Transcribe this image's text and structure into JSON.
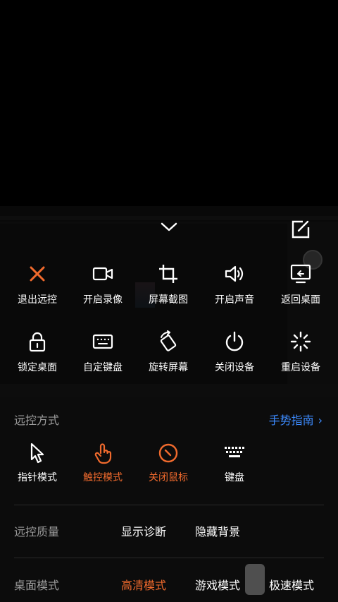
{
  "toolbar": {
    "row1": [
      {
        "label": "退出远控",
        "icon": "close-icon"
      },
      {
        "label": "开启录像",
        "icon": "video-camera-icon"
      },
      {
        "label": "屏幕截图",
        "icon": "crop-icon"
      },
      {
        "label": "开启声音",
        "icon": "speaker-icon"
      },
      {
        "label": "返回桌面",
        "icon": "monitor-return-icon"
      }
    ],
    "row2": [
      {
        "label": "锁定桌面",
        "icon": "lock-icon"
      },
      {
        "label": "自定键盘",
        "icon": "keyboard-icon"
      },
      {
        "label": "旋转屏幕",
        "icon": "rotate-screen-icon"
      },
      {
        "label": "关闭设备",
        "icon": "power-icon"
      },
      {
        "label": "重启设备",
        "icon": "loading-spinner-icon"
      }
    ]
  },
  "remote_mode": {
    "title": "远控方式",
    "guide_label": "手势指南",
    "modes": [
      {
        "label": "指针模式",
        "icon": "pointer-cursor-icon",
        "active": false
      },
      {
        "label": "触控模式",
        "icon": "touch-hand-icon",
        "active": true
      },
      {
        "label": "关闭鼠标",
        "icon": "mouse-off-icon",
        "active": true
      },
      {
        "label": "键盘",
        "icon": "keyboard-icon",
        "active": false
      }
    ]
  },
  "quality": {
    "title": "远控质量",
    "options": [
      "显示诊断",
      "隐藏背景"
    ]
  },
  "desktop_mode": {
    "title": "桌面模式",
    "options": [
      {
        "label": "高清模式",
        "active": true
      },
      {
        "label": "游戏模式",
        "active": false
      },
      {
        "label": "极速模式",
        "active": false
      }
    ]
  },
  "colors": {
    "accent": "#f06a2d",
    "link": "#3d8bff",
    "muted": "#9a9a9a"
  }
}
